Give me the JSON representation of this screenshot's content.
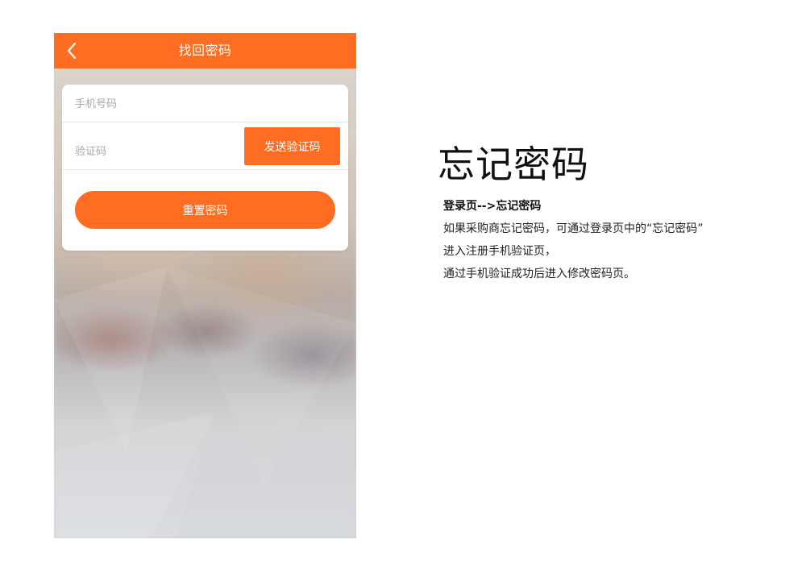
{
  "colors": {
    "accent": "#ff6d23",
    "card": "#ffffff",
    "divider": "#e6e6e6",
    "placeholder": "#a8a8a8"
  },
  "phone": {
    "nav": {
      "title": "找回密码",
      "back_icon": "chevron-left-icon"
    },
    "form": {
      "phone_placeholder": "手机号码",
      "code_placeholder": "验证码",
      "send_code_label": "发送验证码",
      "reset_label": "重置密码"
    }
  },
  "description": {
    "title": "忘记密码",
    "flow": "登录页-->忘记密码",
    "lines": [
      "如果采购商忘记密码，可通过登录页中的“忘记密码”",
      "进入注册手机验证页，",
      "通过手机验证成功后进入修改密码页。"
    ]
  }
}
